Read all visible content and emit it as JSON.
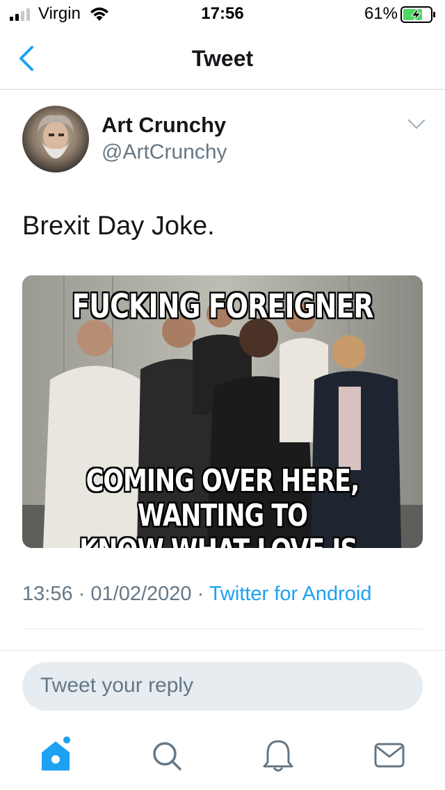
{
  "status_bar": {
    "carrier": "Virgin",
    "time": "17:56",
    "battery_percent": "61%"
  },
  "nav": {
    "title": "Tweet",
    "back_icon": "chevron-left-icon"
  },
  "tweet": {
    "author_name": "Art Crunchy",
    "author_handle": "@ArtCrunchy",
    "text": "Brexit Day Joke.",
    "media": {
      "top_caption": "FUCKING FOREIGNER",
      "bottom_caption_line1": "COMING OVER HERE, WANTING TO",
      "bottom_caption_line2": "KNOW WHAT LOVE IS."
    },
    "time": "13:56",
    "date": "01/02/2020",
    "separator": "·",
    "source": "Twitter for Android"
  },
  "reply": {
    "placeholder": "Tweet your reply"
  },
  "tab_bar": {
    "items": [
      "home-icon",
      "search-icon",
      "notifications-icon",
      "messages-icon"
    ]
  },
  "colors": {
    "accent": "#1da1f2",
    "secondary_text": "#657786",
    "reply_bg": "#e6ecf0"
  }
}
